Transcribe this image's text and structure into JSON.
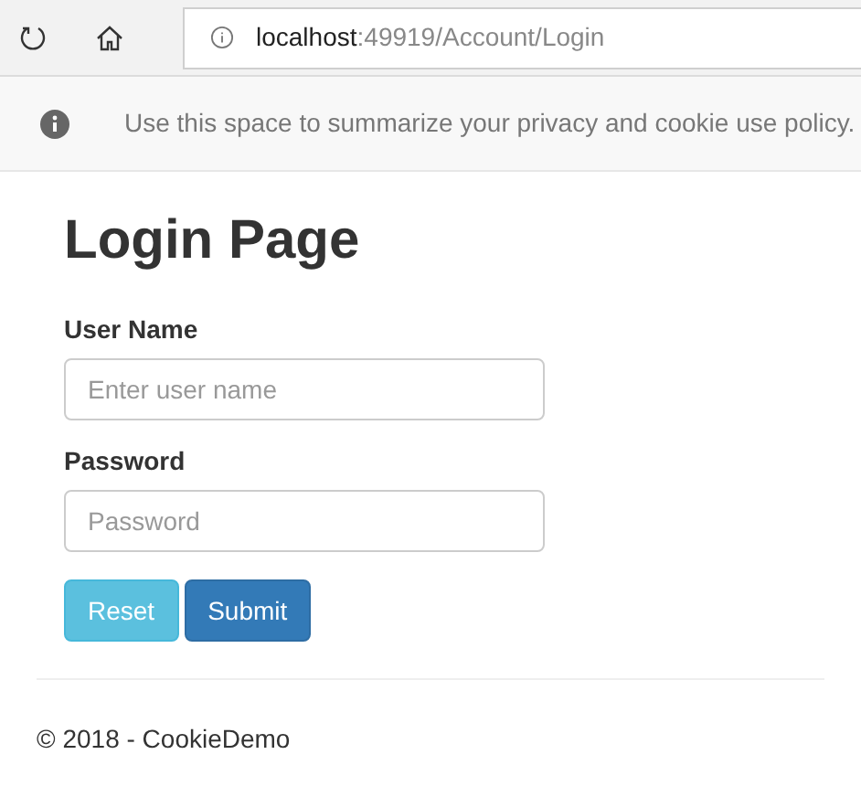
{
  "browser": {
    "address": {
      "host": "localhost",
      "path": ":49919/Account/Login"
    }
  },
  "cookie_banner": {
    "text": "Use this space to summarize your privacy and cookie use policy."
  },
  "page": {
    "title": "Login Page",
    "fields": [
      {
        "label": "User Name",
        "placeholder": "Enter user name"
      },
      {
        "label": "Password",
        "placeholder": "Password"
      }
    ],
    "buttons": [
      {
        "label": "Reset",
        "kind": "info"
      },
      {
        "label": "Submit",
        "kind": "primary"
      }
    ]
  },
  "footer": {
    "text": "© 2018 - CookieDemo"
  }
}
